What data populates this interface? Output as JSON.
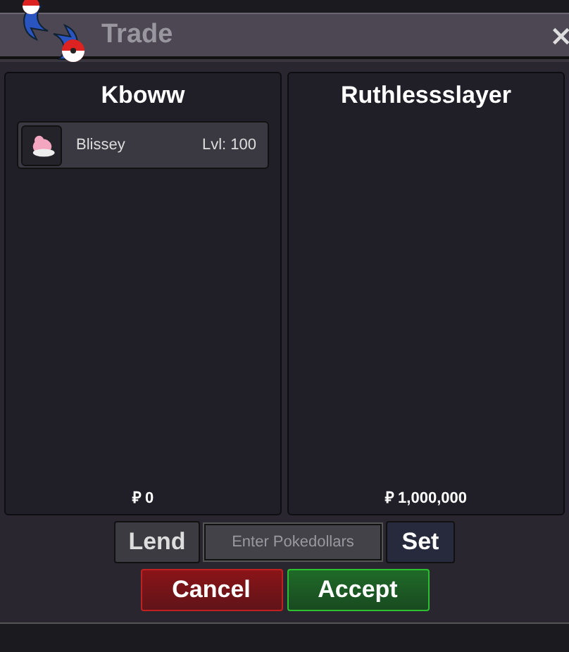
{
  "window": {
    "title": "Trade",
    "close": "×"
  },
  "panels": [
    {
      "trainer": "Kboww",
      "items": [
        {
          "name": "Blissey",
          "level": "Lvl: 100"
        }
      ],
      "money": "₽ 0"
    },
    {
      "trainer": "Ruthlessslayer",
      "money": "₽ 1,000,000"
    }
  ],
  "lend_button": "Lend",
  "amount_field": {
    "placeholder": "Enter Pokedollars"
  },
  "set_button": "Set",
  "actions": [
    {
      "label": "Cancel",
      "kind": "cancel"
    },
    {
      "label": "Accept",
      "kind": "accept"
    }
  ]
}
